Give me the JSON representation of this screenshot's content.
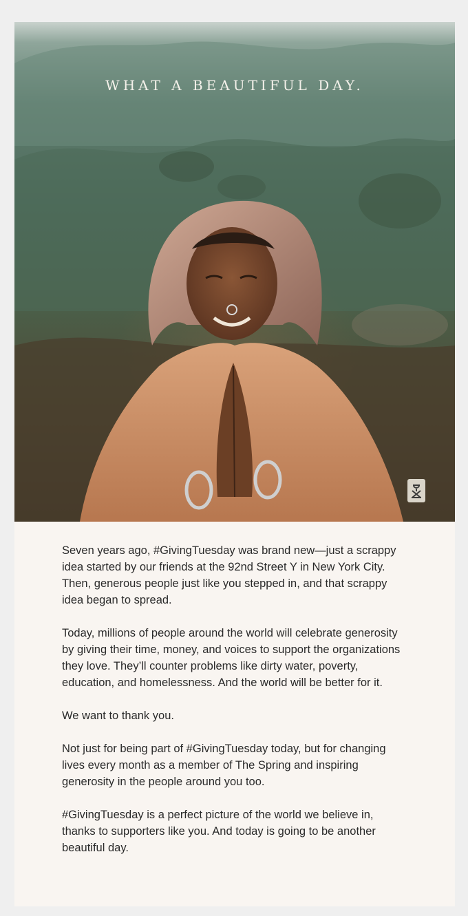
{
  "hero": {
    "tagline": "WHAT A BEAUTIFUL DAY.",
    "logo_icon": "jerry-can-logo-icon",
    "colors": {
      "sky": "#c9d2cd",
      "hills": "#5f7d6f",
      "ground": "#3e3426",
      "shawl": "#c98e62",
      "headscarf": "#b08a7a",
      "skin": "#7a4a2e"
    }
  },
  "body": {
    "paragraphs": [
      "Seven years ago, #GivingTuesday was brand new—just a scrappy idea started by our friends at the 92nd Street Y in New York City. Then, generous people just like you stepped in, and that scrappy idea began to spread.",
      "Today, millions of people around the world will celebrate generosity by giving their time, money, and voices to support the organizations they love. They’ll counter problems like dirty water, poverty, education, and homelessness. And the world will be better for it.",
      "We want to thank you.",
      "Not just for being part of #GivingTuesday today, but for changing lives every month as a member of The Spring and inspiring generosity in the people around you too.",
      "#GivingTuesday is a perfect picture of the world we believe in, thanks to supporters like you. And today is going to be another beautiful day."
    ]
  },
  "colors": {
    "page_background": "#efefef",
    "card_background": "#f9f5f1",
    "text": "#2a2a2a",
    "tagline": "#f4f1ea"
  }
}
